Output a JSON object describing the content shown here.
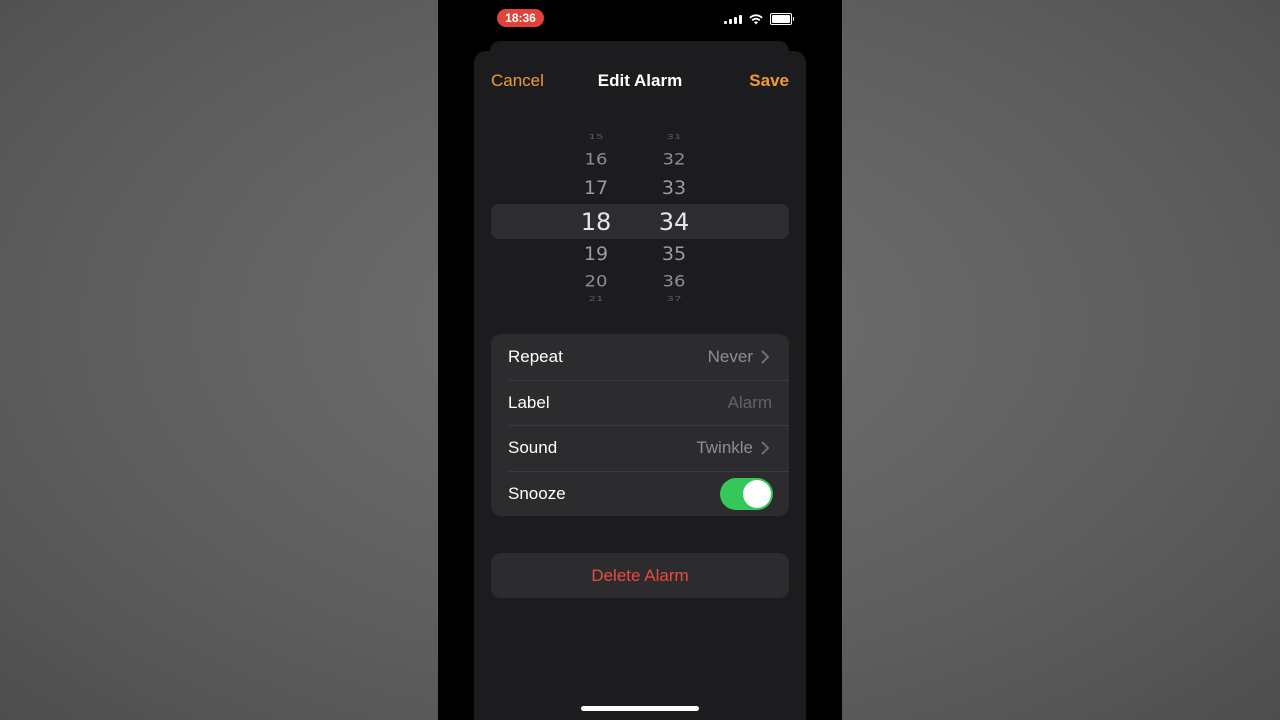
{
  "status_bar": {
    "time": "18:36"
  },
  "nav": {
    "cancel": "Cancel",
    "title": "Edit Alarm",
    "save": "Save"
  },
  "picker": {
    "hours": [
      "15",
      "16",
      "17",
      "18",
      "19",
      "20",
      "21"
    ],
    "minutes": [
      "31",
      "32",
      "33",
      "34",
      "35",
      "36",
      "37"
    ],
    "selected_hour": "18",
    "selected_minute": "34"
  },
  "settings": {
    "repeat": {
      "label": "Repeat",
      "value": "Never"
    },
    "label": {
      "label": "Label",
      "placeholder": "Alarm"
    },
    "sound": {
      "label": "Sound",
      "value": "Twinkle"
    },
    "snooze": {
      "label": "Snooze",
      "on": true
    }
  },
  "delete_label": "Delete Alarm",
  "colors": {
    "accent": "#f09a37",
    "destructive": "#eb4a40",
    "toggle_on": "#34c759",
    "time_pill": "#e0433a"
  }
}
